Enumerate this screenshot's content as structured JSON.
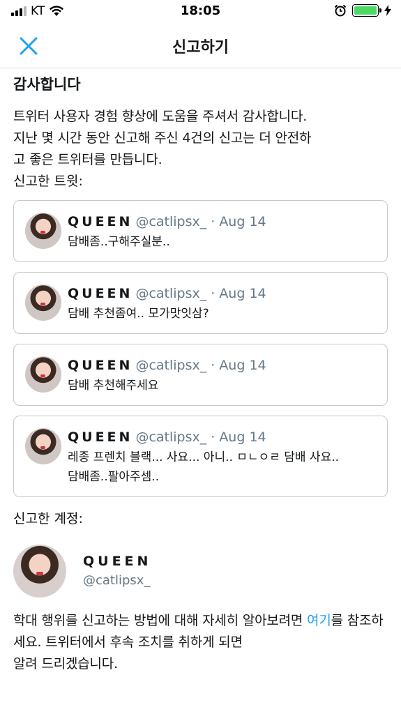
{
  "status_bar": {
    "carrier": "KT",
    "time": "18:05"
  },
  "header": {
    "title": "신고하기",
    "close_icon": "close-icon"
  },
  "content": {
    "thanks_title": "감사합니다",
    "intro_line1": "트위터 사용자 경험 향상에 도움을 주셔서 감사합니다.",
    "intro_line2": "지난 몇 시간 동안 신고해 주신 4건의 신고는 더 안전하",
    "intro_line3": "고 좋은 트위터를 만듭니다.",
    "reported_tweets_label": "신고한 트윗:",
    "tweets": [
      {
        "name": "QUEEN",
        "handle": "@catlipsx_",
        "dot": "·",
        "date": "Aug 14",
        "line1": "담배좀..구해주실분..",
        "line2": ""
      },
      {
        "name": "QUEEN",
        "handle": "@catlipsx_",
        "dot": "·",
        "date": "Aug 14",
        "line1": "담배 추천좀여.. 모가맛잇삼?",
        "line2": ""
      },
      {
        "name": "QUEEN",
        "handle": "@catlipsx_",
        "dot": "·",
        "date": "Aug 14",
        "line1": "담배 추천해주세요",
        "line2": ""
      },
      {
        "name": "QUEEN",
        "handle": "@catlipsx_",
        "dot": "·",
        "date": "Aug 14",
        "line1": "레종 프렌치 블랙... 사요... 아니.. ㅁㄴㅇㄹ 담배 사요..",
        "line2": "담배좀..팔아주셈.."
      }
    ],
    "reported_account_label": "신고한 계정:",
    "account": {
      "name": "QUEEN",
      "handle": "@catlipsx_"
    },
    "footer_part1": "학대 행위를 신고하는 방법에 대해 자세히 알아보려면 ",
    "footer_link": "여기",
    "footer_part2": "를 참조하세요. 트위터에서 후속 조치를 취하게 되면",
    "footer_line3": "알려 드리겠습니다."
  },
  "colors": {
    "accent": "#1da1f2",
    "battery": "#4cd964",
    "secondary_text": "#657786",
    "border": "#c4c9cd"
  }
}
